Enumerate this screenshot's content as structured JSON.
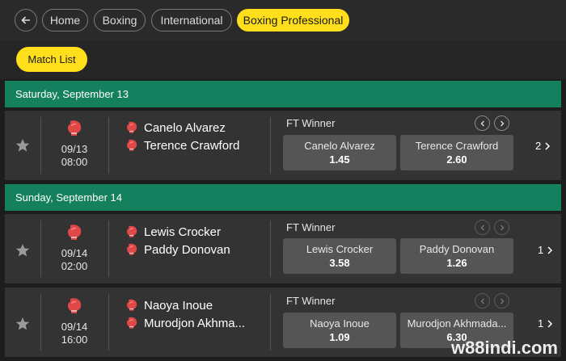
{
  "breadcrumbs": [
    {
      "label": "Home"
    },
    {
      "label": "Boxing"
    },
    {
      "label": "International"
    },
    {
      "label": "Boxing Professional"
    }
  ],
  "match_list_label": "Match List",
  "dates": [
    {
      "label": "Saturday,  September 13"
    },
    {
      "label": "Sunday,  September 14"
    }
  ],
  "events": [
    {
      "date": "09/13",
      "time": "08:00",
      "player1": "Canelo Alvarez",
      "player2": "Terence Crawford",
      "market": "FT Winner",
      "odds": [
        {
          "name": "Canelo Alvarez",
          "price": "1.45"
        },
        {
          "name": "Terence Crawford",
          "price": "2.60"
        }
      ],
      "more": "2"
    },
    {
      "date": "09/14",
      "time": "02:00",
      "player1": "Lewis Crocker",
      "player2": "Paddy Donovan",
      "market": "FT Winner",
      "odds": [
        {
          "name": "Lewis Crocker",
          "price": "3.58"
        },
        {
          "name": "Paddy Donovan",
          "price": "1.26"
        }
      ],
      "more": "1"
    },
    {
      "date": "09/14",
      "time": "16:00",
      "player1": "Naoya Inoue",
      "player2": "Murodjon Akhma...",
      "market": "FT Winner",
      "odds": [
        {
          "name": "Naoya Inoue",
          "price": "1.09"
        },
        {
          "name": "Murodjon Akhmada...",
          "price": "6.30"
        }
      ],
      "more": "1"
    }
  ],
  "icons": {
    "back": "arrow-left-icon",
    "star": "star-icon",
    "glove": "boxing-glove-icon",
    "prev": "chevron-left-icon",
    "next": "chevron-right-icon"
  },
  "colors": {
    "accent_yellow": "#ffdf1b",
    "date_green": "#14805e",
    "glove_red": "#e04848"
  },
  "watermark": "w88indi.com"
}
